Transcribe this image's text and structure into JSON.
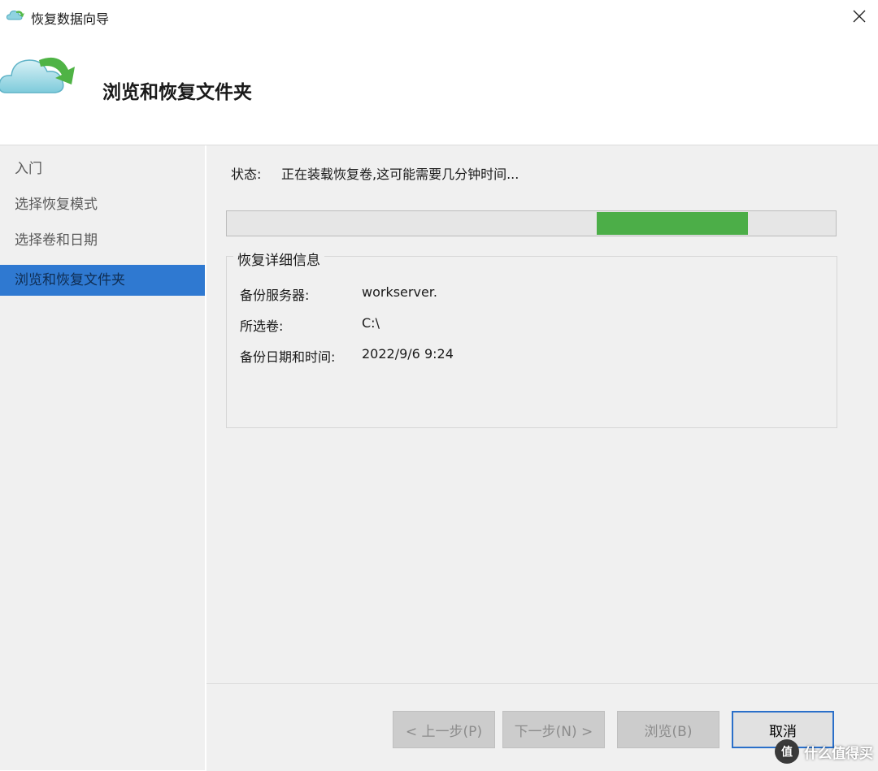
{
  "window": {
    "title": "恢复数据向导",
    "close_icon": "close-icon"
  },
  "banner": {
    "title": "浏览和恢复文件夹",
    "icon": "cloud-restore-icon"
  },
  "sidebar": {
    "items": [
      {
        "label": "入门",
        "active": false
      },
      {
        "label": "选择恢复模式",
        "active": false
      },
      {
        "label": "选择卷和日期",
        "active": false
      },
      {
        "label": "浏览和恢复文件夹",
        "active": true
      }
    ]
  },
  "status": {
    "label": "状态:",
    "text": "正在装载恢复卷,这可能需要几分钟时间..."
  },
  "progress": {
    "style": "marquee",
    "fill_color": "#4cae48"
  },
  "details": {
    "title": "恢复详细信息",
    "rows": [
      {
        "label": "备份服务器:",
        "value": "workserver."
      },
      {
        "label": "所选卷:",
        "value": "C:\\"
      },
      {
        "label": "备份日期和时间:",
        "value": "2022/9/6 9:24"
      }
    ]
  },
  "buttons": {
    "prev": "< 上一步(P)",
    "next": "下一步(N) >",
    "browse": "浏览(B)",
    "cancel": "取消"
  },
  "watermark": {
    "badge": "值",
    "text": "什么值得买"
  },
  "colors": {
    "accent": "#2f79d1",
    "progress": "#4cae48",
    "panel": "#f0f0f0"
  }
}
